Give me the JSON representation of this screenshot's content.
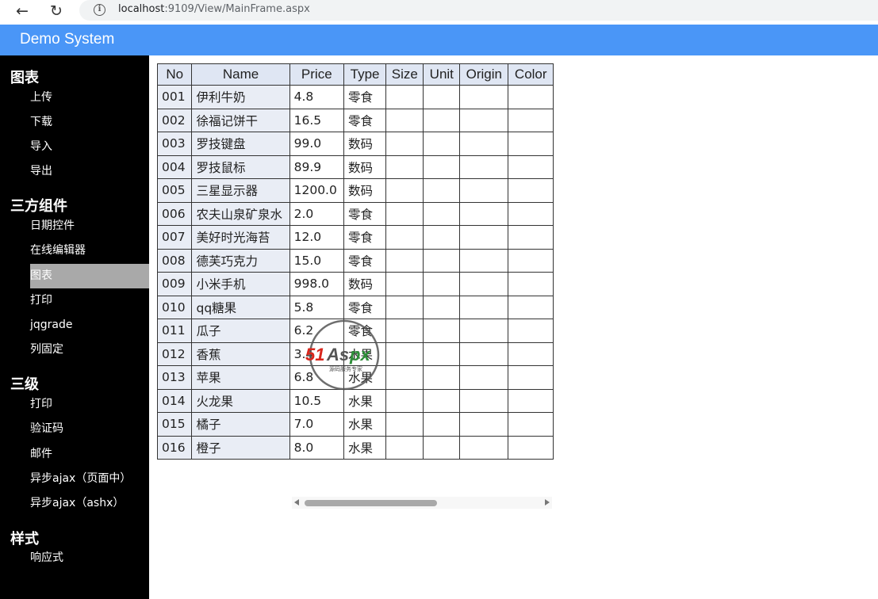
{
  "browser": {
    "url_host": "localhost",
    "url_rest": ":9109/View/MainFrame.aspx"
  },
  "app": {
    "title": "Demo System"
  },
  "sidebar": {
    "groups": [
      {
        "label": "图表",
        "items": [
          "上传",
          "下载",
          "导入",
          "导出"
        ]
      },
      {
        "label": "三方组件",
        "items": [
          "日期控件",
          "在线编辑器",
          "图表",
          "打印",
          "jqgrade",
          "列固定"
        ]
      },
      {
        "label": "三级",
        "items": [
          "打印",
          "验证码",
          "邮件",
          "异步ajax（页面中）",
          "异步ajax（ashx）"
        ]
      },
      {
        "label": "样式",
        "items": [
          "响应式"
        ]
      }
    ],
    "active_item": "图表"
  },
  "table": {
    "headers": [
      "No",
      "Name",
      "Price",
      "Type",
      "Size",
      "Unit",
      "Origin",
      "Color"
    ],
    "rows": [
      [
        "001",
        "伊利牛奶",
        "4.8",
        "零食"
      ],
      [
        "002",
        "徐福记饼干",
        "16.5",
        "零食"
      ],
      [
        "003",
        "罗技键盘",
        "99.0",
        "数码"
      ],
      [
        "004",
        "罗技鼠标",
        "89.9",
        "数码"
      ],
      [
        "005",
        "三星显示器",
        "1200.0",
        "数码"
      ],
      [
        "006",
        "农夫山泉矿泉水",
        "2.0",
        "零食"
      ],
      [
        "007",
        "美好时光海苔",
        "12.0",
        "零食"
      ],
      [
        "008",
        "德芙巧克力",
        "15.0",
        "零食"
      ],
      [
        "009",
        "小米手机",
        "998.0",
        "数码"
      ],
      [
        "010",
        "qq糖果",
        "5.8",
        "零食"
      ],
      [
        "011",
        "瓜子",
        "6.2",
        "零食"
      ],
      [
        "012",
        "香蕉",
        "3.4",
        "水果"
      ],
      [
        "013",
        "苹果",
        "6.8",
        "水果"
      ],
      [
        "014",
        "火龙果",
        "10.5",
        "水果"
      ],
      [
        "015",
        "橘子",
        "7.0",
        "水果"
      ],
      [
        "016",
        "橙子",
        "8.0",
        "水果"
      ]
    ]
  },
  "watermark": {
    "logo_text": "51Aspx",
    "tagline": "源码服务专家"
  },
  "colors": {
    "appbar": "#4a96f7",
    "sidebar": "#000000",
    "active_item": "#a9a9a9",
    "header_cell": "#dfe6f3"
  }
}
